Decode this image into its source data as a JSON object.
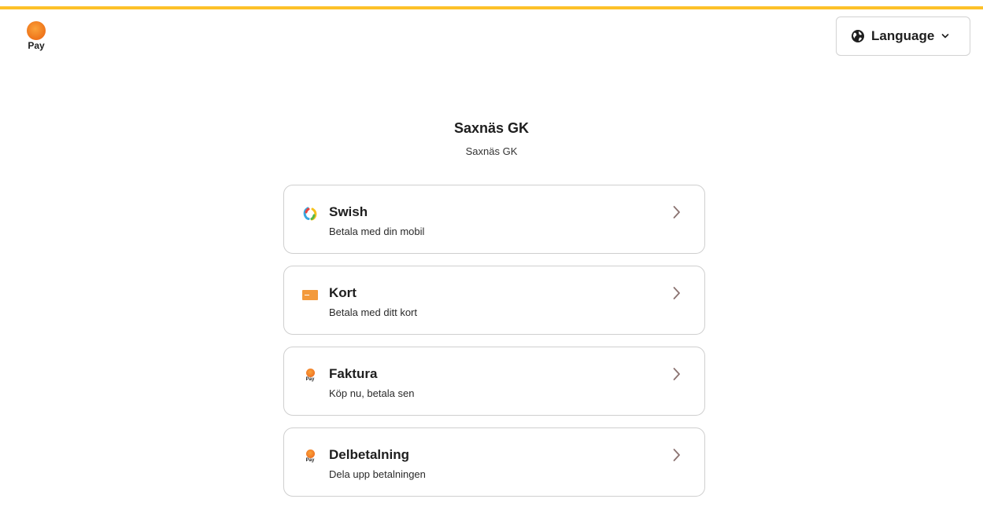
{
  "brand": {
    "logo_text": "Pay",
    "accent_color": "#fdc129",
    "logo_color": "#f07a1e"
  },
  "header": {
    "language_label": "Language",
    "language_icon": "globe-icon",
    "dropdown_icon": "chevron-down-icon"
  },
  "merchant": {
    "title": "Saxnäs GK",
    "subtitle": "Saxnäs GK"
  },
  "methods": [
    {
      "title": "Swish",
      "description": "Betala med din mobil",
      "icon": "swish-icon"
    },
    {
      "title": "Kort",
      "description": "Betala med ditt kort",
      "icon": "card-icon"
    },
    {
      "title": "Faktura",
      "description": "Köp nu, betala sen",
      "icon": "pay-logo-icon",
      "icon_text": "Pay"
    },
    {
      "title": "Delbetalning",
      "description": "Dela upp betalningen",
      "icon": "pay-logo-icon",
      "icon_text": "Pay"
    }
  ]
}
